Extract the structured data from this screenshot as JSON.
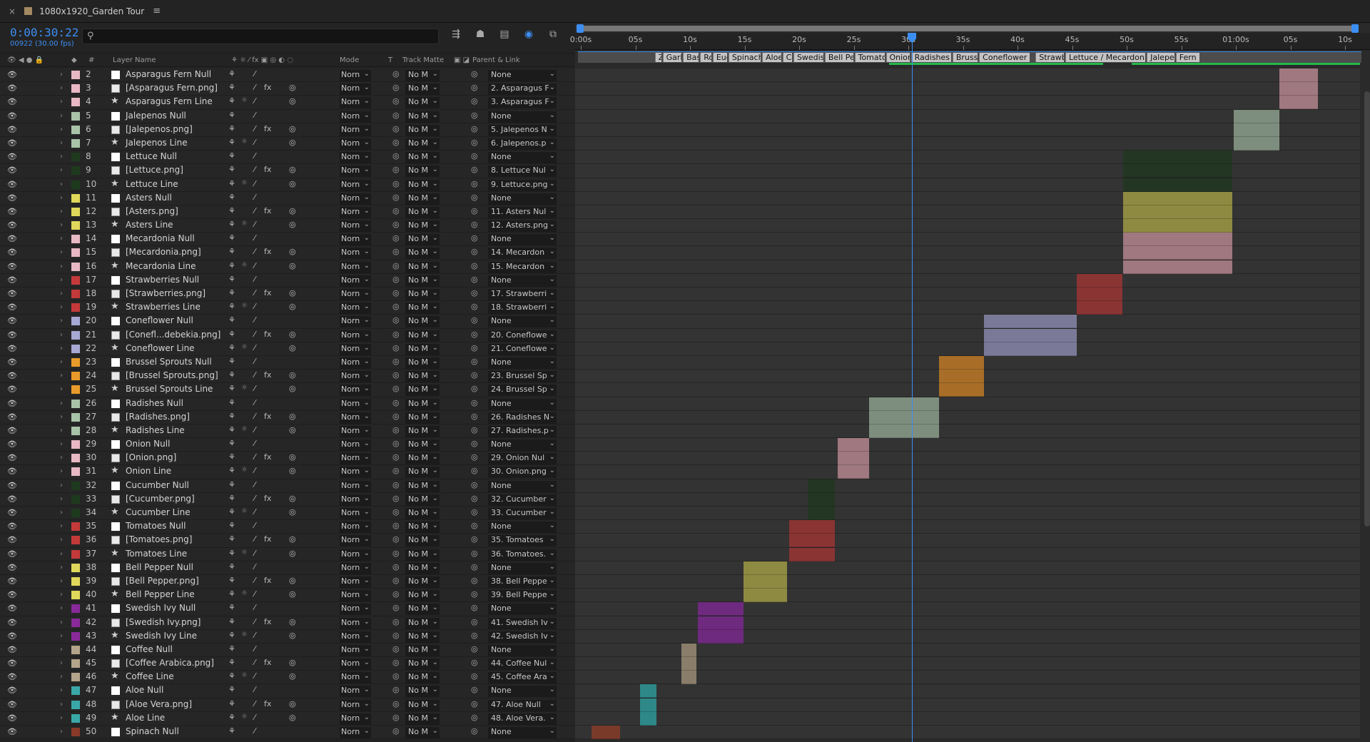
{
  "window": {
    "title": "1080x1920_Garden Tour",
    "close": "×",
    "menu": "≡"
  },
  "time": {
    "current": "0:00:30:22",
    "frames": "00922 (30.00 fps)"
  },
  "columns": {
    "layer_name": "Layer Name",
    "hash": "#",
    "mode": "Mode",
    "t": "T",
    "track_matte": "Track Matte",
    "parent_link": "Parent & Link"
  },
  "ruler": [
    "0:00s",
    "05s",
    "10s",
    "15s",
    "20s",
    "25s",
    "30s",
    "35s",
    "40s",
    "45s",
    "50s",
    "55s",
    "01:00s",
    "05s",
    "10s"
  ],
  "markers": [
    {
      "label": "Z",
      "pos": 0.098
    },
    {
      "label": "Garl",
      "pos": 0.108
    },
    {
      "label": "Bas",
      "pos": 0.134
    },
    {
      "label": "Ro",
      "pos": 0.156
    },
    {
      "label": "Euc",
      "pos": 0.172
    },
    {
      "label": "Spinach",
      "pos": 0.192
    },
    {
      "label": "Aloe",
      "pos": 0.235
    },
    {
      "label": "Co",
      "pos": 0.261
    },
    {
      "label": "Swedish",
      "pos": 0.275
    },
    {
      "label": "Bell Pep",
      "pos": 0.315
    },
    {
      "label": "Tomato",
      "pos": 0.353
    },
    {
      "label": "Onion",
      "pos": 0.393
    },
    {
      "label": "Radishes",
      "pos": 0.425
    },
    {
      "label": "Brussel",
      "pos": 0.478
    },
    {
      "label": "Coneflower",
      "pos": 0.512
    },
    {
      "label": "Strawbe",
      "pos": 0.584
    },
    {
      "label": "Lettuce / Mecardonia",
      "pos": 0.622
    },
    {
      "label": "Jalepeno",
      "pos": 0.726
    },
    {
      "label": "Fern",
      "pos": 0.763
    }
  ],
  "layers": [
    {
      "num": "2",
      "name": "Asparagus Fern Null",
      "type": "solid",
      "color": "#e8b8c4",
      "mode": "Norn",
      "matte": "No M",
      "parent": "None"
    },
    {
      "num": "3",
      "name": "[Asparagus Fern.png]",
      "type": "file",
      "color": "#e8b8c4",
      "mode": "Norn",
      "matte": "No M",
      "parent": "2. Asparagus F"
    },
    {
      "num": "4",
      "name": "Asparagus Fern Line",
      "type": "star",
      "color": "#e8b8c4",
      "mode": "Norn",
      "matte": "No M",
      "parent": "3. Asparagus F"
    },
    {
      "num": "5",
      "name": "Jalepenos Null",
      "type": "solid",
      "color": "#a8c4a8",
      "mode": "Norn",
      "matte": "No M",
      "parent": "None"
    },
    {
      "num": "6",
      "name": "[Jalepenos.png]",
      "type": "file",
      "color": "#a8c4a8",
      "mode": "Norn",
      "matte": "No M",
      "parent": "5. Jalepenos N"
    },
    {
      "num": "7",
      "name": "Jalepenos Line",
      "type": "star",
      "color": "#a8c4a8",
      "mode": "Norn",
      "matte": "No M",
      "parent": "6. Jalepenos.p"
    },
    {
      "num": "8",
      "name": "Lettuce Null",
      "type": "solid",
      "color": "#1e3a1e",
      "mode": "Norn",
      "matte": "No M",
      "parent": "None"
    },
    {
      "num": "9",
      "name": "[Lettuce.png]",
      "type": "file",
      "color": "#1e3a1e",
      "mode": "Norn",
      "matte": "No M",
      "parent": "8. Lettuce Nul"
    },
    {
      "num": "10",
      "name": "Lettuce Line",
      "type": "star",
      "color": "#1e3a1e",
      "mode": "Norn",
      "matte": "No M",
      "parent": "9. Lettuce.png"
    },
    {
      "num": "11",
      "name": "Asters Null",
      "type": "solid",
      "color": "#e0d85a",
      "mode": "Norn",
      "matte": "No M",
      "parent": "None"
    },
    {
      "num": "12",
      "name": "[Asters.png]",
      "type": "file",
      "color": "#e0d85a",
      "mode": "Norn",
      "matte": "No M",
      "parent": "11. Asters Nul"
    },
    {
      "num": "13",
      "name": "Asters Line",
      "type": "star",
      "color": "#e0d85a",
      "mode": "Norn",
      "matte": "No M",
      "parent": "12. Asters.png"
    },
    {
      "num": "14",
      "name": "Mecardonia Null",
      "type": "solid",
      "color": "#e8b8c4",
      "mode": "Norn",
      "matte": "No M",
      "parent": "None"
    },
    {
      "num": "15",
      "name": "[Mecardonia.png]",
      "type": "file",
      "color": "#e8b8c4",
      "mode": "Norn",
      "matte": "No M",
      "parent": "14. Mecardon"
    },
    {
      "num": "16",
      "name": "Mecardonia Line",
      "type": "star",
      "color": "#e8b8c4",
      "mode": "Norn",
      "matte": "No M",
      "parent": "15. Mecardon"
    },
    {
      "num": "17",
      "name": "Strawberries Null",
      "type": "solid",
      "color": "#c43a3a",
      "mode": "Norn",
      "matte": "No M",
      "parent": "None"
    },
    {
      "num": "18",
      "name": "[Strawberries.png]",
      "type": "file",
      "color": "#c43a3a",
      "mode": "Norn",
      "matte": "No M",
      "parent": "17. Strawberri"
    },
    {
      "num": "19",
      "name": "Strawberries Line",
      "type": "star",
      "color": "#c43a3a",
      "mode": "Norn",
      "matte": "No M",
      "parent": "18. Strawberri"
    },
    {
      "num": "20",
      "name": "Coneflower Null",
      "type": "solid",
      "color": "#a8a8d4",
      "mode": "Norn",
      "matte": "No M",
      "parent": "None"
    },
    {
      "num": "21",
      "name": "[Conefl...debekia.png]",
      "type": "file",
      "color": "#a8a8d4",
      "mode": "Norn",
      "matte": "No M",
      "parent": "20. Coneflowe"
    },
    {
      "num": "22",
      "name": "Coneflower Line",
      "type": "star",
      "color": "#a8a8d4",
      "mode": "Norn",
      "matte": "No M",
      "parent": "21. Coneflowe"
    },
    {
      "num": "23",
      "name": "Brussel Sprouts Null",
      "type": "solid",
      "color": "#e89a2a",
      "mode": "Norn",
      "matte": "No M",
      "parent": "None"
    },
    {
      "num": "24",
      "name": "[Brussel Sprouts.png]",
      "type": "file",
      "color": "#e89a2a",
      "mode": "Norn",
      "matte": "No M",
      "parent": "23. Brussel Sp"
    },
    {
      "num": "25",
      "name": "Brussel Sprouts Line",
      "type": "star",
      "color": "#e89a2a",
      "mode": "Norn",
      "matte": "No M",
      "parent": "24. Brussel Sp"
    },
    {
      "num": "26",
      "name": "Radishes Null",
      "type": "solid",
      "color": "#a8c4a8",
      "mode": "Norn",
      "matte": "No M",
      "parent": "None"
    },
    {
      "num": "27",
      "name": "[Radishes.png]",
      "type": "file",
      "color": "#a8c4a8",
      "mode": "Norn",
      "matte": "No M",
      "parent": "26. Radishes N"
    },
    {
      "num": "28",
      "name": "Radishes Line",
      "type": "star",
      "color": "#a8c4a8",
      "mode": "Norn",
      "matte": "No M",
      "parent": "27. Radishes.p"
    },
    {
      "num": "29",
      "name": "Onion Null",
      "type": "solid",
      "color": "#e8b8c4",
      "mode": "Norn",
      "matte": "No M",
      "parent": "None"
    },
    {
      "num": "30",
      "name": "[Onion.png]",
      "type": "file",
      "color": "#e8b8c4",
      "mode": "Norn",
      "matte": "No M",
      "parent": "29. Onion Nul"
    },
    {
      "num": "31",
      "name": "Onion Line",
      "type": "star",
      "color": "#e8b8c4",
      "mode": "Norn",
      "matte": "No M",
      "parent": "30. Onion.png"
    },
    {
      "num": "32",
      "name": "Cucumber Null",
      "type": "solid",
      "color": "#1e3a1e",
      "mode": "Norn",
      "matte": "No M",
      "parent": "None"
    },
    {
      "num": "33",
      "name": "[Cucumber.png]",
      "type": "file",
      "color": "#1e3a1e",
      "mode": "Norn",
      "matte": "No M",
      "parent": "32. Cucumber"
    },
    {
      "num": "34",
      "name": "Cucumber Line",
      "type": "star",
      "color": "#1e3a1e",
      "mode": "Norn",
      "matte": "No M",
      "parent": "33. Cucumber"
    },
    {
      "num": "35",
      "name": "Tomatoes Null",
      "type": "solid",
      "color": "#c43a3a",
      "mode": "Norn",
      "matte": "No M",
      "parent": "None"
    },
    {
      "num": "36",
      "name": "[Tomatoes.png]",
      "type": "file",
      "color": "#c43a3a",
      "mode": "Norn",
      "matte": "No M",
      "parent": "35. Tomatoes"
    },
    {
      "num": "37",
      "name": "Tomatoes Line",
      "type": "star",
      "color": "#c43a3a",
      "mode": "Norn",
      "matte": "No M",
      "parent": "36. Tomatoes."
    },
    {
      "num": "38",
      "name": "Bell Pepper Null",
      "type": "solid",
      "color": "#e0d85a",
      "mode": "Norn",
      "matte": "No M",
      "parent": "None"
    },
    {
      "num": "39",
      "name": "[Bell Pepper.png]",
      "type": "file",
      "color": "#e0d85a",
      "mode": "Norn",
      "matte": "No M",
      "parent": "38. Bell Peppe"
    },
    {
      "num": "40",
      "name": "Bell Pepper Line",
      "type": "star",
      "color": "#e0d85a",
      "mode": "Norn",
      "matte": "No M",
      "parent": "39. Bell Peppe"
    },
    {
      "num": "41",
      "name": "Swedish Ivy Null",
      "type": "solid",
      "color": "#8a2a9a",
      "mode": "Norn",
      "matte": "No M",
      "parent": "None"
    },
    {
      "num": "42",
      "name": "[Swedish Ivy.png]",
      "type": "file",
      "color": "#8a2a9a",
      "mode": "Norn",
      "matte": "No M",
      "parent": "41. Swedish Iv"
    },
    {
      "num": "43",
      "name": "Swedish Ivy Line",
      "type": "star",
      "color": "#8a2a9a",
      "mode": "Norn",
      "matte": "No M",
      "parent": "42. Swedish Iv"
    },
    {
      "num": "44",
      "name": "Coffee Null",
      "type": "solid",
      "color": "#b4a48a",
      "mode": "Norn",
      "matte": "No M",
      "parent": "None"
    },
    {
      "num": "45",
      "name": "[Coffee Arabica.png]",
      "type": "file",
      "color": "#b4a48a",
      "mode": "Norn",
      "matte": "No M",
      "parent": "44. Coffee Nul"
    },
    {
      "num": "46",
      "name": "Coffee Line",
      "type": "star",
      "color": "#b4a48a",
      "mode": "Norn",
      "matte": "No M",
      "parent": "45. Coffee Ara"
    },
    {
      "num": "47",
      "name": "Aloe Null",
      "type": "solid",
      "color": "#3aa8a8",
      "mode": "Norn",
      "matte": "No M",
      "parent": "None"
    },
    {
      "num": "48",
      "name": "[Aloe Vera.png]",
      "type": "file",
      "color": "#3aa8a8",
      "mode": "Norn",
      "matte": "No M",
      "parent": "47. Aloe Null"
    },
    {
      "num": "49",
      "name": "Aloe Line",
      "type": "star",
      "color": "#3aa8a8",
      "mode": "Norn",
      "matte": "No M",
      "parent": "48. Aloe Vera."
    },
    {
      "num": "50",
      "name": "Spinach Null",
      "type": "solid",
      "color": "#8a3a2a",
      "mode": "Norn",
      "matte": "No M",
      "parent": "None"
    }
  ],
  "bars": [
    {
      "rows": [
        0,
        1,
        2
      ],
      "start": 64.0,
      "end": 67.5,
      "color": "#a07880"
    },
    {
      "rows": [
        3,
        4,
        5
      ],
      "start": 59.8,
      "end": 64.0,
      "color": "#7e8e7e"
    },
    {
      "rows": [
        6,
        7,
        8
      ],
      "start": 49.7,
      "end": 59.7,
      "color": "#233623"
    },
    {
      "rows": [
        9,
        10,
        11
      ],
      "start": 49.7,
      "end": 59.7,
      "color": "#8e8a42"
    },
    {
      "rows": [
        12,
        13,
        14
      ],
      "start": 49.7,
      "end": 59.7,
      "color": "#a07880"
    },
    {
      "rows": [
        15,
        16,
        17
      ],
      "start": 45.4,
      "end": 49.6,
      "color": "#8a3434"
    },
    {
      "rows": [
        18,
        19,
        20
      ],
      "start": 36.9,
      "end": 45.4,
      "color": "#7a7a98"
    },
    {
      "rows": [
        21,
        22,
        23
      ],
      "start": 32.8,
      "end": 36.9,
      "color": "#a86e28"
    },
    {
      "rows": [
        24,
        25,
        26
      ],
      "start": 26.4,
      "end": 32.8,
      "color": "#7e8e7e"
    },
    {
      "rows": [
        27,
        28,
        29
      ],
      "start": 23.5,
      "end": 26.4,
      "color": "#a07880"
    },
    {
      "rows": [
        30,
        31,
        32
      ],
      "start": 20.8,
      "end": 23.3,
      "color": "#233623"
    },
    {
      "rows": [
        33,
        34,
        35
      ],
      "start": 19.1,
      "end": 23.3,
      "color": "#8a3434"
    },
    {
      "rows": [
        36,
        37,
        38
      ],
      "start": 14.9,
      "end": 18.9,
      "color": "#8e8a42"
    },
    {
      "rows": [
        39,
        40,
        41
      ],
      "start": 10.7,
      "end": 14.9,
      "color": "#6e2a7e"
    },
    {
      "rows": [
        42,
        43,
        44
      ],
      "start": 9.2,
      "end": 10.6,
      "color": "#8a7e6a"
    },
    {
      "rows": [
        45,
        46,
        47
      ],
      "start": 5.4,
      "end": 6.9,
      "color": "#2e8888"
    },
    {
      "rows": [
        48
      ],
      "start": 1.0,
      "end": 3.6,
      "color": "#7a3a2a"
    }
  ]
}
